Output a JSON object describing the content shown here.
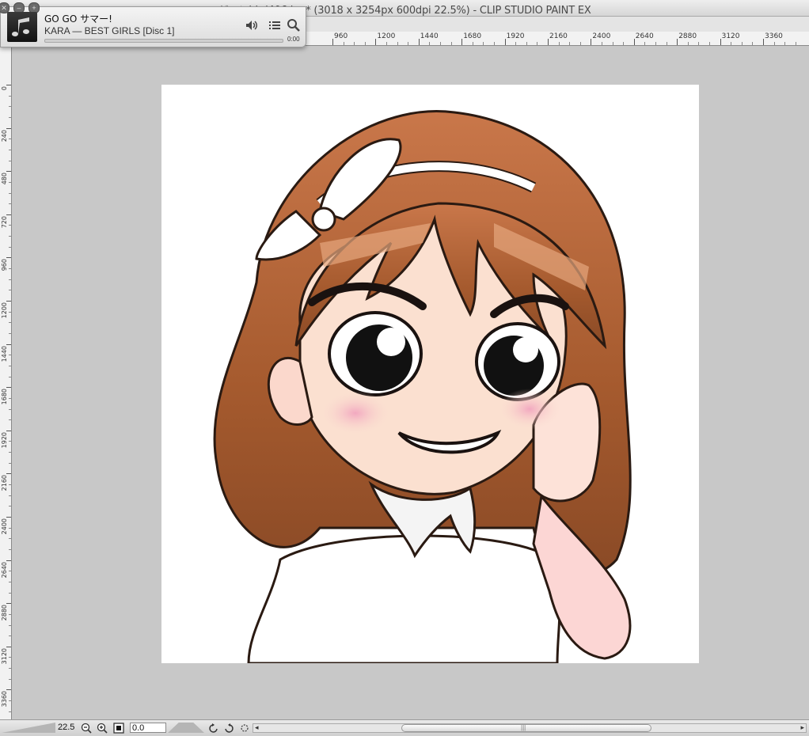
{
  "window": {
    "title": "ジョンbhd406.jpg* (3018 x 3254px 600dpi 22.5%)  - CLIP STUDIO PAINT EX"
  },
  "player": {
    "close_glyph": "✕",
    "min_glyph": "–",
    "zoom_glyph": "+",
    "track_title": "GO GO サマー!",
    "track_subtitle": "KARA — BEST GIRLS [Disc 1]",
    "time": "0:00",
    "progress": 0.0,
    "icons": [
      "music-note-icon",
      "speaker-icon",
      "list-icon",
      "search-icon"
    ]
  },
  "ruler": {
    "top_labels": [
      "960",
      "1200",
      "1440",
      "1680",
      "1920",
      "2160",
      "2400",
      "2640",
      "2880",
      "3120",
      "3360"
    ],
    "left_labels": [
      "0",
      "240",
      "480",
      "720",
      "960",
      "1200",
      "1440",
      "1680",
      "1920",
      "2160",
      "2400",
      "2640",
      "2880",
      "3120",
      "3360"
    ]
  },
  "status": {
    "zoom": "22.5",
    "rotation": "0.0",
    "icons": [
      "zoom-out-icon",
      "zoom-in-icon",
      "fit-icon",
      "rotate-left-icon",
      "rotate-right-icon",
      "reset-view-icon",
      "scroll-left-icon",
      "scroll-right-icon"
    ]
  },
  "colors": {
    "hair": "#b26a3c",
    "skin": "#fbe0d0",
    "blush": "#f4b7c8",
    "background": "#c8c8c8"
  }
}
